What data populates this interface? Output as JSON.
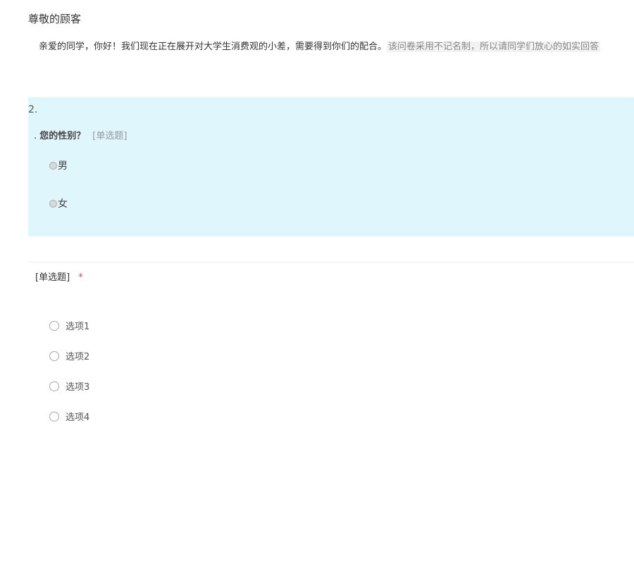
{
  "header": {
    "greeting": "尊敬的顾客",
    "intro_text": "亲爱的同学，你好！我们现在正在展开对大学生消费观的小差，需要得到你们的配合。",
    "intro_note": "该问卷采用不记名制，所以请同学们放心的如实回答"
  },
  "question1": {
    "number": "2.",
    "prefix": ". ",
    "title": "您的性别？",
    "type_label": "[单选题]",
    "options": [
      {
        "label": "男"
      },
      {
        "label": "女"
      }
    ]
  },
  "question2": {
    "type_label": "[单选题]",
    "required_mark": "*",
    "options": [
      {
        "label": "选项1"
      },
      {
        "label": "选项2"
      },
      {
        "label": "选项3"
      },
      {
        "label": "选项4"
      }
    ]
  },
  "colors": {
    "highlight_background": "#dff6fd",
    "required": "#e34a4a"
  }
}
